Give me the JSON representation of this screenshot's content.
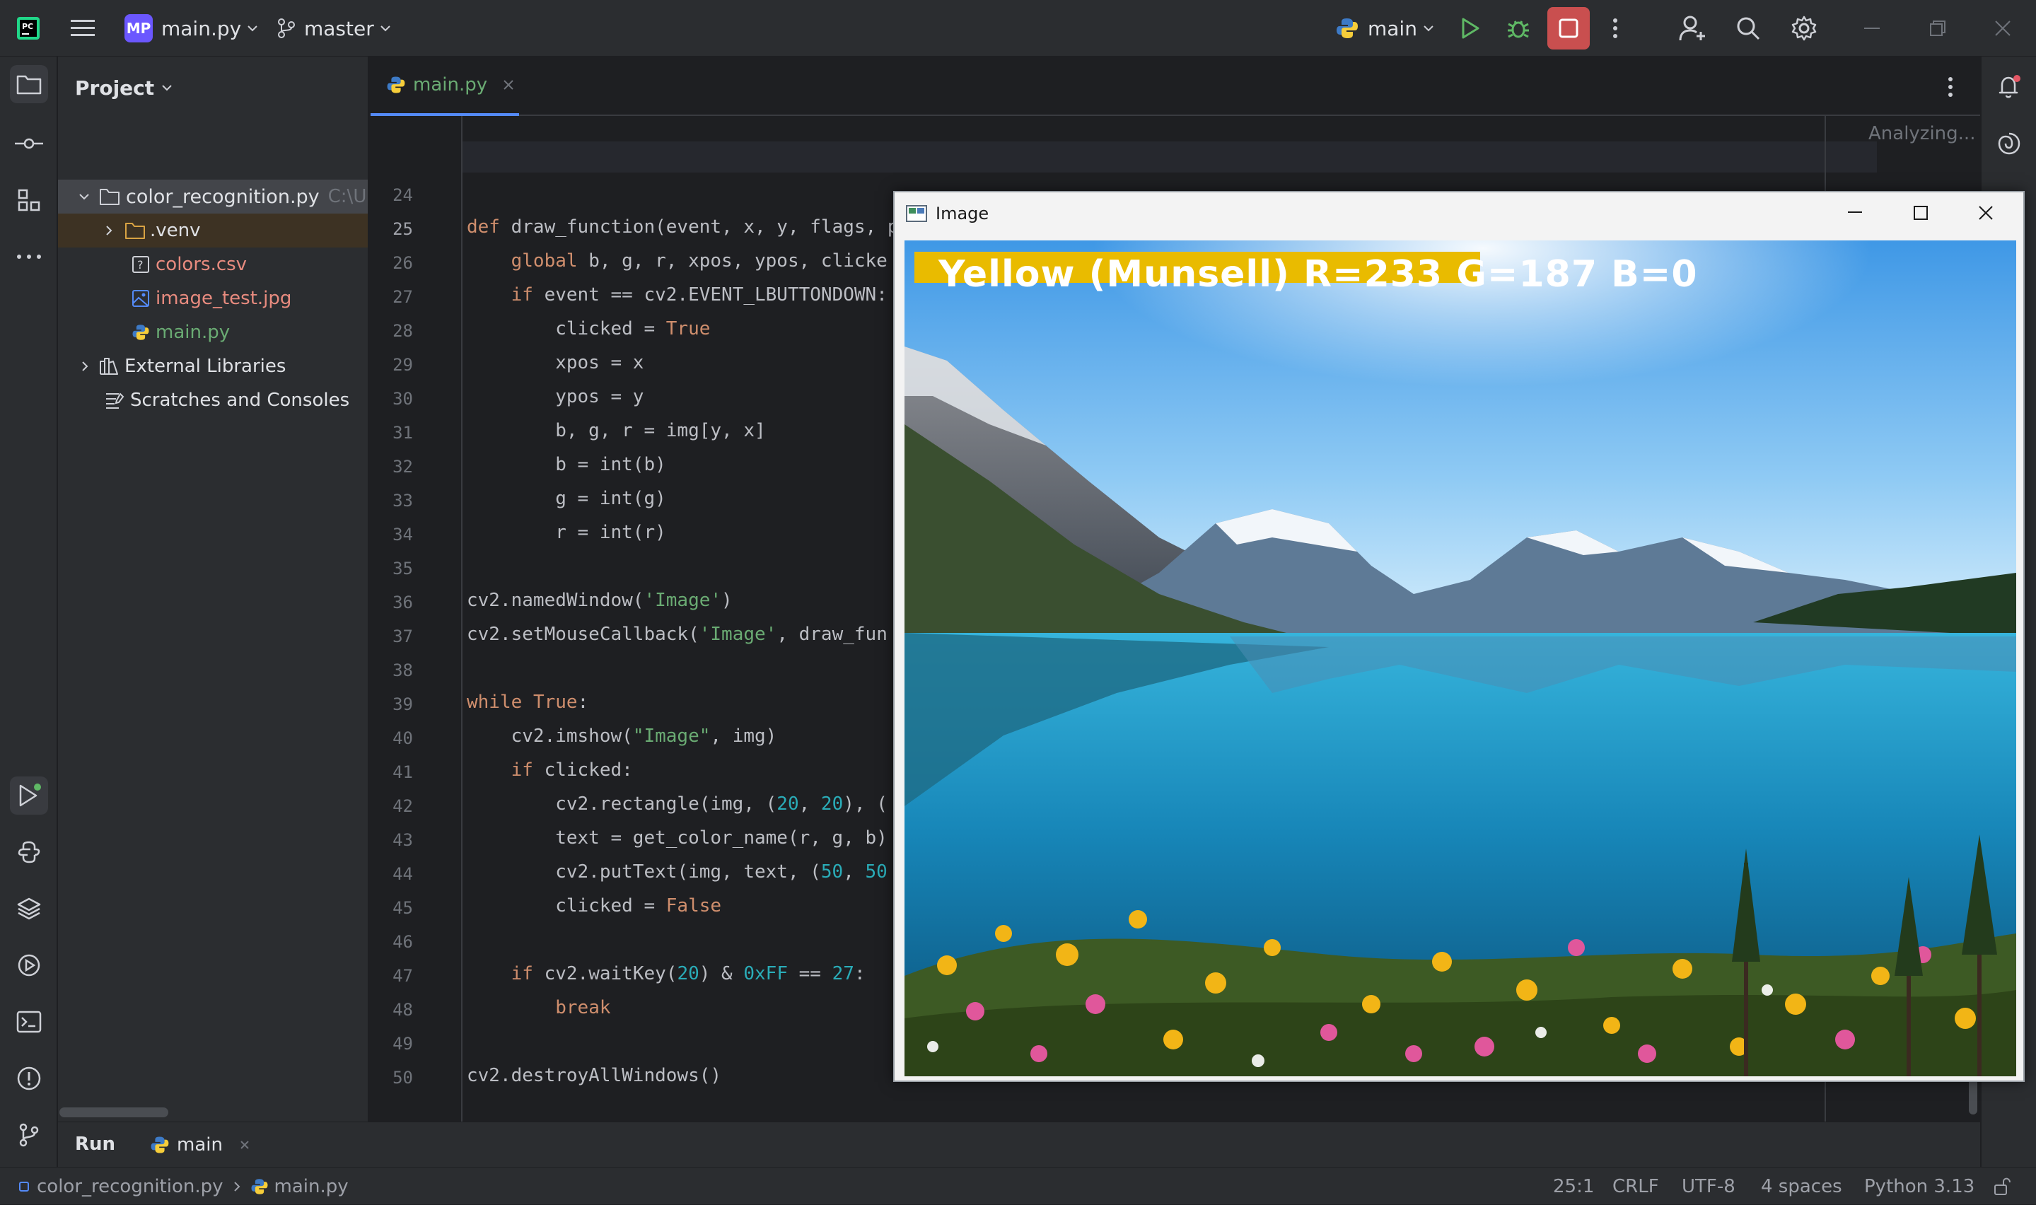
{
  "titlebar": {
    "project_initials": "MP",
    "project_name": "main.py",
    "branch": "master",
    "run_config": "main"
  },
  "project_panel": {
    "title": "Project",
    "root": {
      "name": "color_recognition.py",
      "path": "C:\\U"
    },
    "items": [
      {
        "name": ".venv"
      },
      {
        "name": "colors.csv"
      },
      {
        "name": "image_test.jpg"
      },
      {
        "name": "main.py"
      },
      {
        "name": "External Libraries"
      },
      {
        "name": "Scratches and Consoles"
      }
    ]
  },
  "editor": {
    "tab": "main.py",
    "analyzing": "Analyzing...",
    "lines": [
      {
        "n": "24",
        "code": ""
      },
      {
        "n": "25",
        "code": "def draw_function(event, x, y, flags, param):"
      },
      {
        "n": "26",
        "code": "    global b, g, r, xpos, ypos, clicke"
      },
      {
        "n": "27",
        "code": "    if event == cv2.EVENT_LBUTTONDOWN:"
      },
      {
        "n": "28",
        "code": "        clicked = True"
      },
      {
        "n": "29",
        "code": "        xpos = x"
      },
      {
        "n": "30",
        "code": "        ypos = y"
      },
      {
        "n": "31",
        "code": "        b, g, r = img[y, x]"
      },
      {
        "n": "32",
        "code": "        b = int(b)"
      },
      {
        "n": "33",
        "code": "        g = int(g)"
      },
      {
        "n": "34",
        "code": "        r = int(r)"
      },
      {
        "n": "35",
        "code": ""
      },
      {
        "n": "36",
        "code": "cv2.namedWindow('Image')"
      },
      {
        "n": "37",
        "code": "cv2.setMouseCallback('Image', draw_fun"
      },
      {
        "n": "38",
        "code": ""
      },
      {
        "n": "39",
        "code": "while True:"
      },
      {
        "n": "40",
        "code": "    cv2.imshow(\"Image\", img)"
      },
      {
        "n": "41",
        "code": "    if clicked:"
      },
      {
        "n": "42",
        "code": "        cv2.rectangle(img, (20, 20), ("
      },
      {
        "n": "43",
        "code": "        text = get_color_name(r, g, b)"
      },
      {
        "n": "44",
        "code": "        cv2.putText(img, text, (50, 50"
      },
      {
        "n": "45",
        "code": "        clicked = False"
      },
      {
        "n": "46",
        "code": ""
      },
      {
        "n": "47",
        "code": "    if cv2.waitKey(20) & 0xFF == 27:"
      },
      {
        "n": "48",
        "code": "        break"
      },
      {
        "n": "49",
        "code": ""
      },
      {
        "n": "50",
        "code": "cv2.destroyAllWindows()"
      }
    ]
  },
  "image_window": {
    "title": "Image",
    "overlay_text": "Yellow (Munsell) R=233 G=187 B=0",
    "overlay_color": "#e9bb00"
  },
  "run_panel": {
    "label": "Run",
    "config": "main"
  },
  "status": {
    "breadcrumb_project": "color_recognition.py",
    "breadcrumb_file": "main.py",
    "position": "25:1",
    "line_sep": "CRLF",
    "encoding": "UTF-8",
    "indent": "4 spaces",
    "interpreter": "Python 3.13"
  },
  "colors": {
    "accent": "#3574f0",
    "stop": "#c94f4f",
    "run": "#5fb865",
    "keyword": "#cf8e6d",
    "number": "#2aacb8",
    "string": "#6aab73"
  }
}
